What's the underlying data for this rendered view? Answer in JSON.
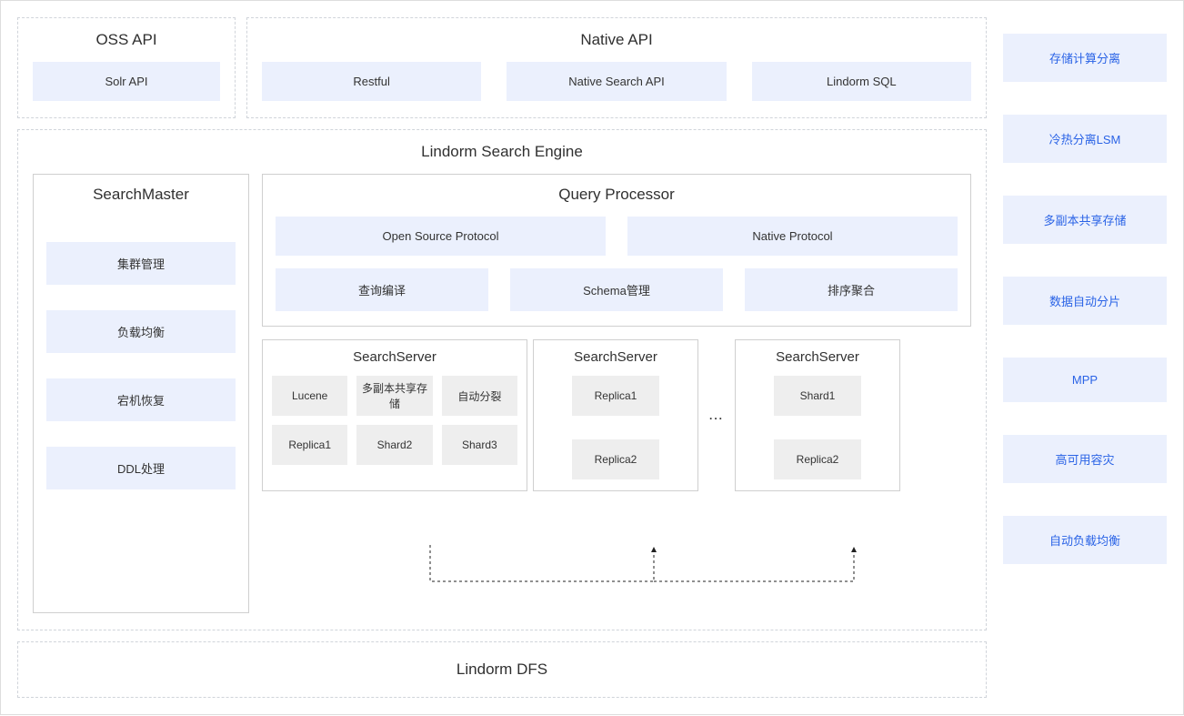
{
  "api_row": {
    "oss": {
      "title": "OSS API",
      "items": [
        "Solr API"
      ]
    },
    "native": {
      "title": "Native API",
      "items": [
        "Restful",
        "Native Search API",
        "Lindorm SQL"
      ]
    }
  },
  "engine": {
    "title": "Lindorm Search Engine",
    "search_master": {
      "title": "SearchMaster",
      "items": [
        "集群管理",
        "负载均衡",
        "宕机恢复",
        "DDL处理"
      ]
    },
    "query_processor": {
      "title": "Query Processor",
      "row1": [
        "Open Source Protocol",
        "Native Protocol"
      ],
      "row2": [
        "查询编译",
        "Schema管理",
        "排序聚合"
      ]
    },
    "servers": [
      {
        "title": "SearchServer",
        "cells": [
          "Lucene",
          "多副本共享存储",
          "自动分裂",
          "Replica1",
          "Shard2",
          "Shard3"
        ]
      },
      {
        "title": "SearchServer",
        "cells": [
          "Replica1",
          "Replica2"
        ]
      },
      {
        "title": "SearchServer",
        "cells": [
          "Shard1",
          "Replica2"
        ]
      }
    ],
    "ellipsis": "..."
  },
  "dfs": {
    "title": "Lindorm DFS"
  },
  "features": [
    "存储计算分离",
    "冷热分离LSM",
    "多副本共享存储",
    "数据自动分片",
    "MPP",
    "高可用容灾",
    "自动负载均衡"
  ]
}
